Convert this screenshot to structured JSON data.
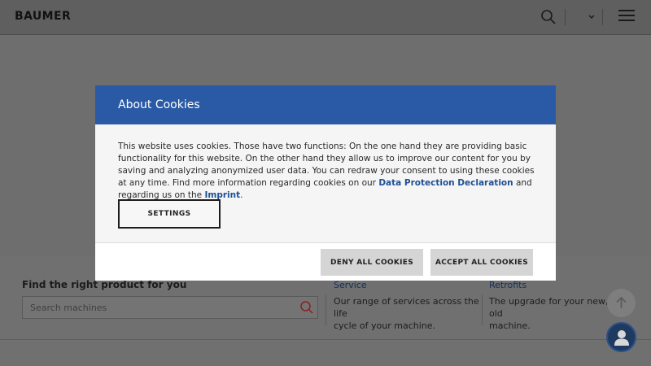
{
  "header": {
    "logo_text": "BAUMER",
    "icons": [
      "search-icon",
      "chevron-down-icon",
      "hamburger-menu-icon"
    ]
  },
  "finder": {
    "title": "Find the right product for you",
    "search_placeholder": "Search machines"
  },
  "columns": [
    {
      "title": "Service",
      "text_line1": "Our range of services across the life",
      "text_line2": "cycle of your machine."
    },
    {
      "title": "Retrofits",
      "text_line1": "The upgrade for your new, old",
      "text_line2": "machine."
    }
  ],
  "modal": {
    "title": "About Cookies",
    "body_text": "This website uses cookies. Those have two functions: On the one hand they are providing basic functionality for this website. On the other hand they allow us to improve our content for you by saving and analyzing anonymized user data. You can redraw your consent to using these cookies at any time. Find more information regarding cookies on our ",
    "link_privacy": "Data Protection Declaration",
    "middle_text": " and regarding us on the ",
    "link_imprint": "Imprint",
    "end_text": ".",
    "settings_label": "SETTINGS",
    "deny_label": "DENY ALL COOKIES",
    "accept_label": "ACCEPT ALL COOKIES"
  },
  "colors": {
    "modal_header": "#2a5aa6",
    "link": "#1f4f94",
    "chat_button": "#1e3a5f"
  }
}
